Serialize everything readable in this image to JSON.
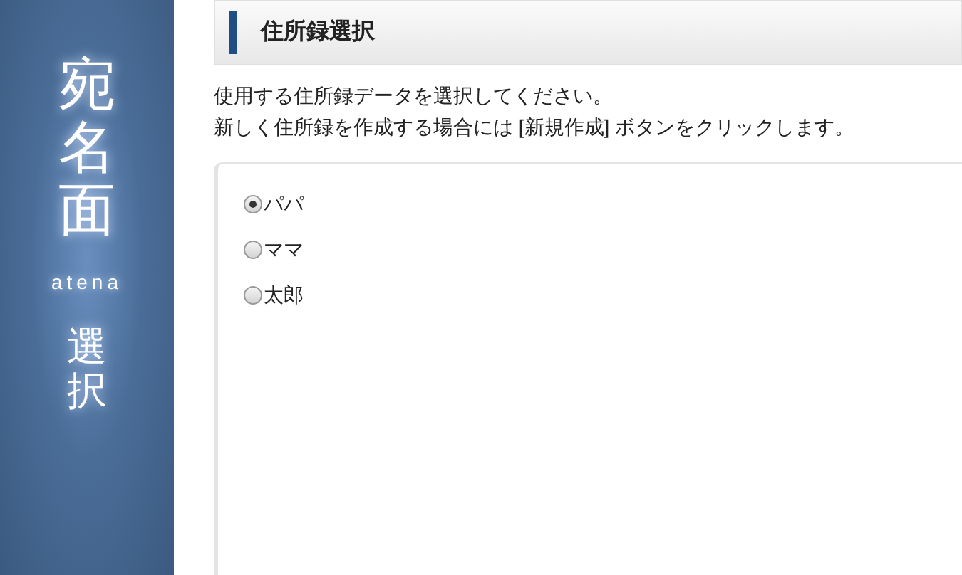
{
  "sidebar": {
    "title": "宛名面",
    "subtitle": "atena",
    "caption": "選択"
  },
  "header": {
    "title": "住所録選択"
  },
  "instructions": [
    "使用する住所録データを選択してください。",
    "新しく住所録を作成する場合には [新規作成] ボタンをクリックします。"
  ],
  "address_books": [
    {
      "label": "パパ",
      "selected": true
    },
    {
      "label": "ママ",
      "selected": false
    },
    {
      "label": "太郎",
      "selected": false
    }
  ]
}
